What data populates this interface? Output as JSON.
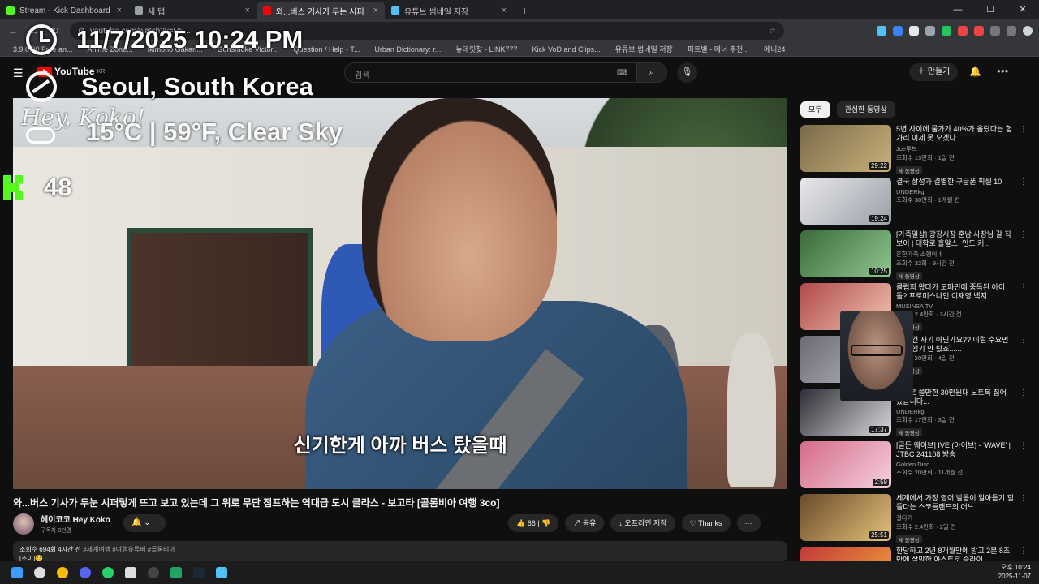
{
  "browser": {
    "tabs": [
      {
        "title": "Stream - Kick Dashboard",
        "color": "#53fc18",
        "active": false
      },
      {
        "title": "새 탭",
        "color": "#9aa0a6",
        "active": false
      },
      {
        "title": "와...버스 기사가 두는 시퍼",
        "color": "#ff0000",
        "active": true
      },
      {
        "title": "유튜브 썸네일 저장",
        "color": "#4fc3f7",
        "active": false
      }
    ],
    "new_tab": "+",
    "url": "youtube.com/watch?v=R5...",
    "bookmarks": [
      "3.9.0.00 Free an...",
      "Anime Zone...",
      "Ikimono Gakari...",
      "Gunsmoke Victor...",
      "Question / Help - T...",
      "Urban Dictionary: r...",
      "뉴데릿찾 - LINK777",
      "Kick VoD and Clips...",
      "유튜브 썸네일 저장",
      "파트별 - 메너 추천...",
      "메니24"
    ]
  },
  "youtube": {
    "logo": "YouTube",
    "region": "KR",
    "search_placeholder": "검색",
    "create_label": "만들기",
    "video": {
      "subtitle": "신기한게 아까 버스 탔을때",
      "title": "와...버스 기사가 두눈 시퍼렇게 뜨고 보고 있는데 그 위로 무단 점프하는 역대급 도시 클라스 - 보고타 [콜롬비아 여행 3co]",
      "channel": "헤이코코 Hey Koko",
      "subscribers": "구독자 8천명",
      "likes": "66",
      "share": "공유",
      "offline": "오프라인 저장",
      "thanks": "Thanks",
      "more": "···",
      "description_views": "조회수 694회 4시간 전",
      "description_tags": "#세계여행 #여행유튜버 #콜롬비아",
      "description_more": "[조이]🙂"
    },
    "chips": [
      "모두",
      "관심한 동영상"
    ],
    "recommendations": [
      {
        "title": "5년 사이에 물가가 40%가 올랐다는 헝가리 이제 못 오겠다...",
        "channel": "Joe투브",
        "meta": "조회수 13만회 · 1일 전",
        "badge": "새 동영상",
        "duration": "29:22",
        "color1": "#7a6a4a",
        "color2": "#c9b27a"
      },
      {
        "title": "결국 삼성과 결별한 구글폰 픽셀 10",
        "channel": "UNDERkg",
        "meta": "조회수 38만회 · 1개월 전",
        "badge": "",
        "duration": "19:24",
        "color1": "#e8e8ea",
        "color2": "#9aa0a8"
      },
      {
        "title": "[가족일상] 광장시장 훈남 사장님 갈 직보이 | 대학로 홀알스, 인도 커...",
        "channel": "혼한가족 소행이네",
        "meta": "조회수 32회 · 9시간 전",
        "badge": "새 동영상",
        "duration": "10:25",
        "color1": "#3b6a3b",
        "color2": "#8fc68f"
      },
      {
        "title": "클럽회 왔다가 도파민에 중독된 아이돌? 프로미스나인 이재영 백지...",
        "channel": "MUSINSA TV",
        "meta": "조회수 2.4만회 · 3시간 전",
        "badge": "새 동영상",
        "duration": "",
        "color1": "#b04a4a",
        "color2": "#f2c6b4"
      },
      {
        "title": "아 이건 사기 아닌가요?? 이럴 수요면 이 비행기 안 탔죠......",
        "channel": "",
        "meta": "조회수 20만회 · 4일 전",
        "badge": "새 동영상",
        "duration": "",
        "color1": "#6a6a72",
        "color2": "#bcbcc4"
      },
      {
        "title": "의외로 쓸만한 30만원대 노트북 집어 왔습니다...",
        "channel": "UNDERkg",
        "meta": "조회수 17만회 · 3일 전",
        "badge": "새 동영상",
        "duration": "17:37",
        "color1": "#2e2e36",
        "color2": "#d8d8dc"
      },
      {
        "title": "[골든 웨이브] IVE (아이브) - 'WAVE' | JTBC 241108 방송",
        "channel": "Golden Disc",
        "meta": "조회수 20만회 · 11개월 전",
        "badge": "",
        "duration": "2:59",
        "color1": "#d46a8a",
        "color2": "#f6d1dc"
      },
      {
        "title": "세계에서 가장 영어 발음이 알아듣기 힘들다는 스코틀랜드의 어느...",
        "channel": "걸다가",
        "meta": "조회수 2.4만회 · 2일 전",
        "badge": "새 동영상",
        "duration": "25:51",
        "color1": "#6b4a2a",
        "color2": "#e4c27a"
      },
      {
        "title": "한당하고 2년 8개월만에 방고 2분 8초만에 살망한 아스트로 슬라이...",
        "channel": "",
        "meta": "",
        "badge": "",
        "duration": "",
        "color1": "#c23a3a",
        "color2": "#f2a23a"
      }
    ]
  },
  "overlay": {
    "datetime": "11/7/2025 10:24 PM",
    "location": "Seoul, South Korea",
    "weather": "15°C | 59°F, Clear Sky",
    "handwritten": "Hey, Koko!",
    "kick_count": "48"
  },
  "taskbar": {
    "apps": [
      "windows-logo",
      "search",
      "chrome",
      "discord",
      "whatsapp",
      "capcut",
      "obs",
      "sheets",
      "steam",
      "app"
    ],
    "time": "오후 10:24",
    "date": "2025-11-07"
  }
}
